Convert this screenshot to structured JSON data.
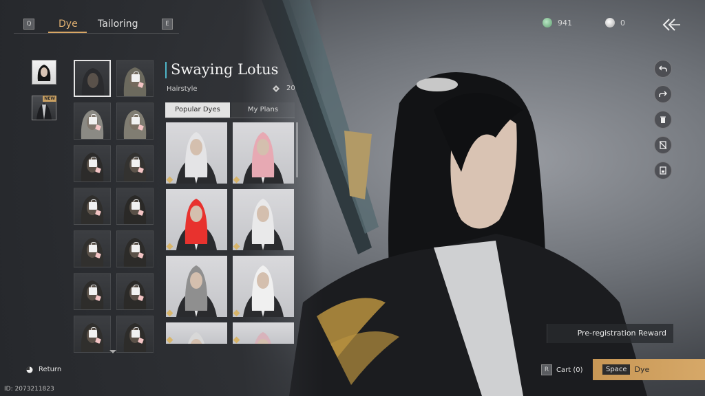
{
  "top_bar": {
    "key_left": "Q",
    "tabs": [
      {
        "label": "Dye",
        "active": true
      },
      {
        "label": "Tailoring",
        "active": false
      }
    ],
    "key_right": "E",
    "currencies": [
      {
        "icon": "jade-coin-icon",
        "value": "941",
        "color": "#7fbf8f"
      },
      {
        "icon": "pearl-coin-icon",
        "value": "0",
        "color": "#e8e8e8"
      }
    ],
    "back_icon": "double-chevron-back-icon"
  },
  "category_column": {
    "items": [
      {
        "icon": "hairstyle-category-icon",
        "badge": ""
      },
      {
        "icon": "outfit-category-icon",
        "badge": "NEW"
      }
    ]
  },
  "dye_grid": {
    "selected_index": 0,
    "locked_count": 13
  },
  "detail": {
    "title": "Swaying Lotus",
    "subtitle": "Hairstyle",
    "count": "20",
    "count_icon": "dye-drop-icon",
    "subtabs": [
      {
        "label": "Popular Dyes",
        "active": true
      },
      {
        "label": "My Plans",
        "active": false
      }
    ]
  },
  "presets": [
    {
      "name": "preset-white-hair"
    },
    {
      "name": "preset-pink-hair"
    },
    {
      "name": "preset-red-hair"
    },
    {
      "name": "preset-silver-hair"
    },
    {
      "name": "preset-grey-hair"
    },
    {
      "name": "preset-white-hair-2"
    },
    {
      "name": "preset-partial-1"
    },
    {
      "name": "preset-partial-2"
    }
  ],
  "tools": [
    {
      "icon": "undo-icon"
    },
    {
      "icon": "redo-icon"
    },
    {
      "icon": "trash-icon"
    },
    {
      "icon": "hide-ui-icon"
    },
    {
      "icon": "save-plan-icon"
    }
  ],
  "bottom": {
    "return_label": "Return",
    "user_id": "ID: 2073211823",
    "reward_label": "Pre-registration Reward",
    "cart_key": "R",
    "cart_label": "Cart (0)",
    "dye_key": "Space",
    "dye_label": "Dye"
  },
  "colors": {
    "accent": "#d9a765",
    "title_marker": "#4fb6c9"
  }
}
